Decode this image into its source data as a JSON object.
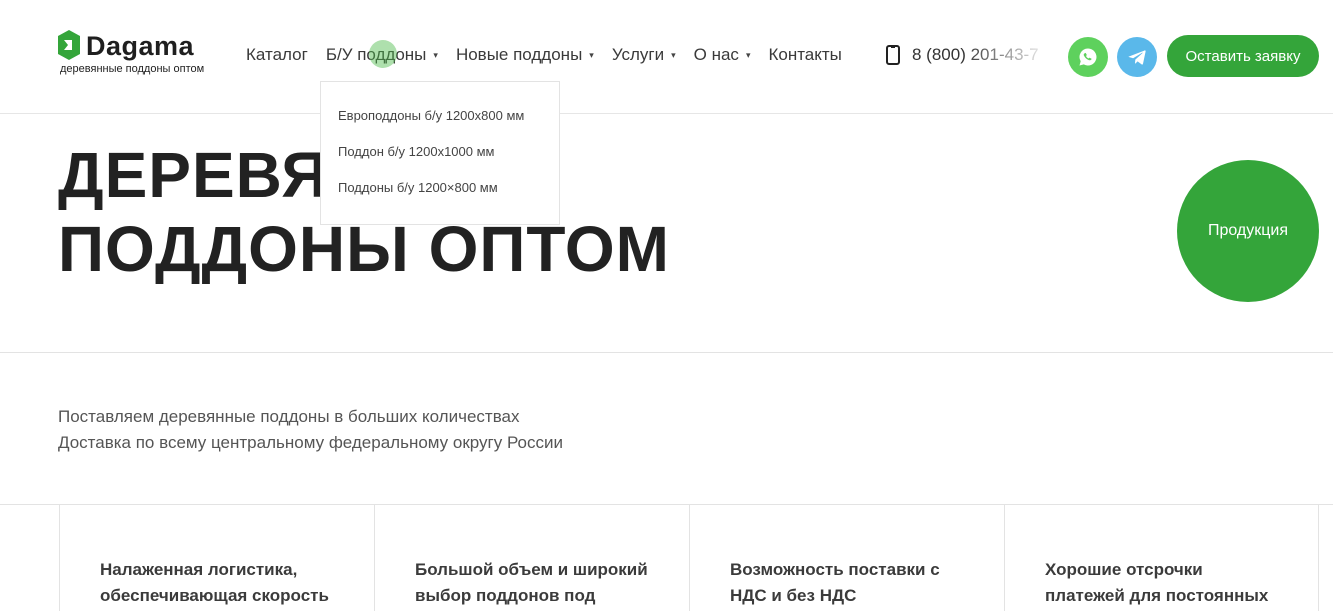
{
  "brand": {
    "name": "Dagama",
    "tagline": "деревянные поддоны оптом",
    "accent_color": "#34a53a"
  },
  "nav": {
    "items": [
      {
        "label": "Каталог",
        "has_caret": false
      },
      {
        "label": "Б/У поддоны",
        "has_caret": true
      },
      {
        "label": "Новые поддоны",
        "has_caret": true
      },
      {
        "label": "Услуги",
        "has_caret": true
      },
      {
        "label": "О нас",
        "has_caret": true
      },
      {
        "label": "Контакты",
        "has_caret": false
      }
    ],
    "caret_glyph": "▾"
  },
  "dropdown": {
    "items": [
      {
        "label": "Европоддоны б/у 1200х800 мм"
      },
      {
        "label": "Поддон б/у 1200х1000 мм"
      },
      {
        "label": "Поддоны б/у 1200×800 мм"
      }
    ]
  },
  "contact": {
    "phone": "8 (800) 201-43-7",
    "phone_icon": "mobile-phone-icon",
    "whatsapp_icon": "whatsapp-icon",
    "telegram_icon": "telegram-icon",
    "cta_label": "Оставить заявку"
  },
  "hero": {
    "title_line1": "ДЕРЕВЯННЫЕ",
    "title_line2": "ПОДДОНЫ ОПТОМ",
    "badge_label": "Продукция",
    "subtitle_line1": "Поставляем деревянные поддоны в больших количествах",
    "subtitle_line2": "Доставка по всему центральному федеральному округу России"
  },
  "features": [
    {
      "line1": "Налаженная логистика,",
      "line2": "обеспечивающая скорость"
    },
    {
      "line1": "Большой объем и широкий",
      "line2": "выбор поддонов под"
    },
    {
      "line1": "Возможность поставки с",
      "line2": "НДС и без НДС"
    },
    {
      "line1": "Хорошие отсрочки",
      "line2": "платежей для постоянных"
    }
  ]
}
